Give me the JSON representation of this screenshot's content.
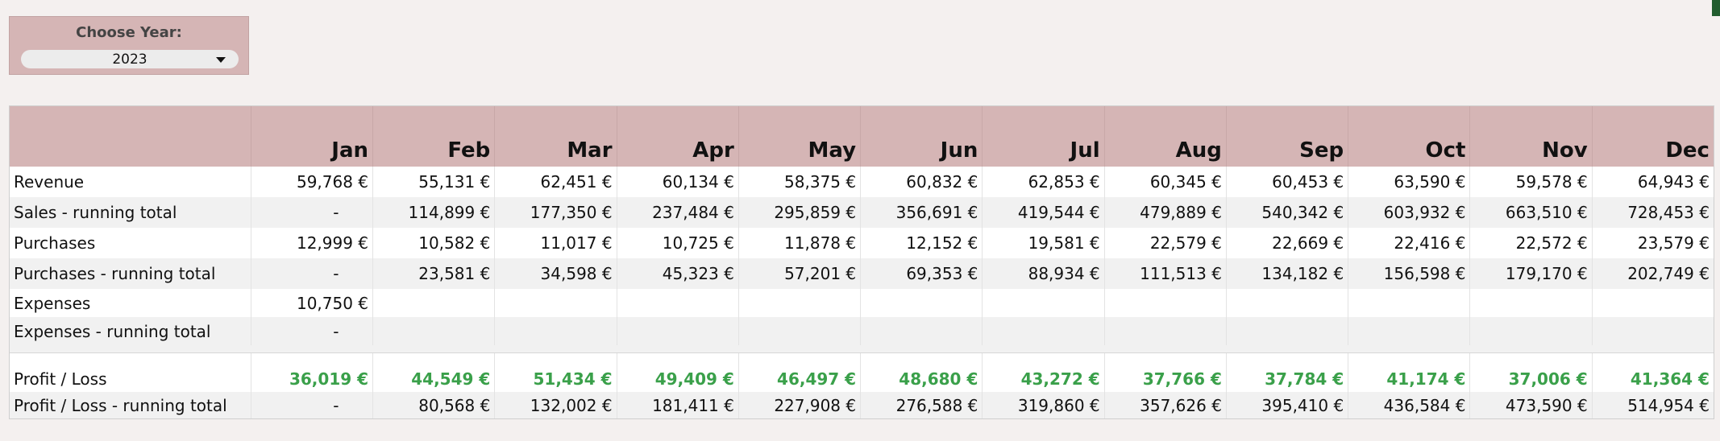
{
  "year_picker": {
    "label": "Choose Year:",
    "value": "2023"
  },
  "table": {
    "months": [
      "Jan",
      "Feb",
      "Mar",
      "Apr",
      "May",
      "Jun",
      "Jul",
      "Aug",
      "Sep",
      "Oct",
      "Nov",
      "Dec"
    ],
    "rows": [
      {
        "label": "Revenue",
        "values": [
          "59,768 €",
          "55,131 €",
          "62,451 €",
          "60,134 €",
          "58,375 €",
          "60,832 €",
          "62,853 €",
          "60,345 €",
          "60,453 €",
          "63,590 €",
          "59,578 €",
          "64,943 €"
        ]
      },
      {
        "label": "Sales - running total",
        "values": [
          "-",
          "114,899 €",
          "177,350 €",
          "237,484 €",
          "295,859 €",
          "356,691 €",
          "419,544 €",
          "479,889 €",
          "540,342 €",
          "603,932 €",
          "663,510 €",
          "728,453 €"
        ]
      },
      {
        "label": "Purchases",
        "values": [
          "12,999 €",
          "10,582 €",
          "11,017 €",
          "10,725 €",
          "11,878 €",
          "12,152 €",
          "19,581 €",
          "22,579 €",
          "22,669 €",
          "22,416 €",
          "22,572 €",
          "23,579 €"
        ]
      },
      {
        "label": "Purchases - running total",
        "values": [
          "-",
          "23,581 €",
          "34,598 €",
          "45,323 €",
          "57,201 €",
          "69,353 €",
          "88,934 €",
          "111,513 €",
          "134,182 €",
          "156,598 €",
          "179,170 €",
          "202,749 €"
        ]
      },
      {
        "label": "Expenses",
        "values": [
          "10,750 €",
          "",
          "",
          "",
          "",
          "",
          "",
          "",
          "",
          "",
          "",
          ""
        ]
      },
      {
        "label": "Expenses - running total",
        "values": [
          "-",
          "",
          "",
          "",
          "",
          "",
          "",
          "",
          "",
          "",
          "",
          ""
        ]
      },
      {
        "label": "Profit / Loss",
        "values": [
          "36,019 €",
          "44,549 €",
          "51,434 €",
          "49,409 €",
          "46,497 €",
          "48,680 €",
          "43,272 €",
          "37,766 €",
          "37,784 €",
          "41,174 €",
          "37,006 €",
          "41,364 €"
        ]
      },
      {
        "label": "Profit / Loss - running total",
        "values": [
          "-",
          "80,568 €",
          "132,002 €",
          "181,411 €",
          "227,908 €",
          "276,588 €",
          "319,860 €",
          "357,626 €",
          "395,410 €",
          "436,584 €",
          "473,590 €",
          "514,954 €"
        ]
      }
    ]
  },
  "colors": {
    "header_bg": "#d5b5b5",
    "profit_text": "#3aa04a",
    "page_bg": "#f4f0ef"
  }
}
